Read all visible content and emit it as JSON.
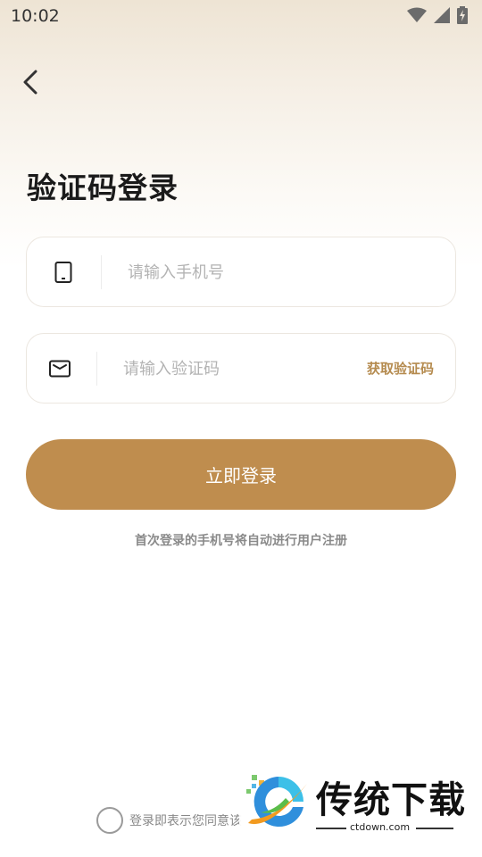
{
  "status_bar": {
    "time": "10:02",
    "icons": [
      "wifi-icon",
      "signal-icon",
      "battery-charging-icon"
    ]
  },
  "nav": {
    "back_icon": "chevron-left-icon"
  },
  "title": "验证码登录",
  "phone_field": {
    "icon": "phone-icon",
    "placeholder": "请输入手机号",
    "value": ""
  },
  "code_field": {
    "icon": "message-icon",
    "placeholder": "请输入验证码",
    "value": "",
    "get_code_label": "获取验证码"
  },
  "login_button": {
    "label": "立即登录"
  },
  "hint": "首次登录的手机号将自动进行用户注册",
  "agreement": {
    "checked": false,
    "text": "登录即表示您同意该"
  },
  "watermark": {
    "name": "传统下载",
    "url": "ctdown.com"
  },
  "colors": {
    "accent": "#bf8d4e",
    "accent_text": "#b58b4f",
    "placeholder": "#b3b3b3",
    "title": "#1a1a1a"
  }
}
